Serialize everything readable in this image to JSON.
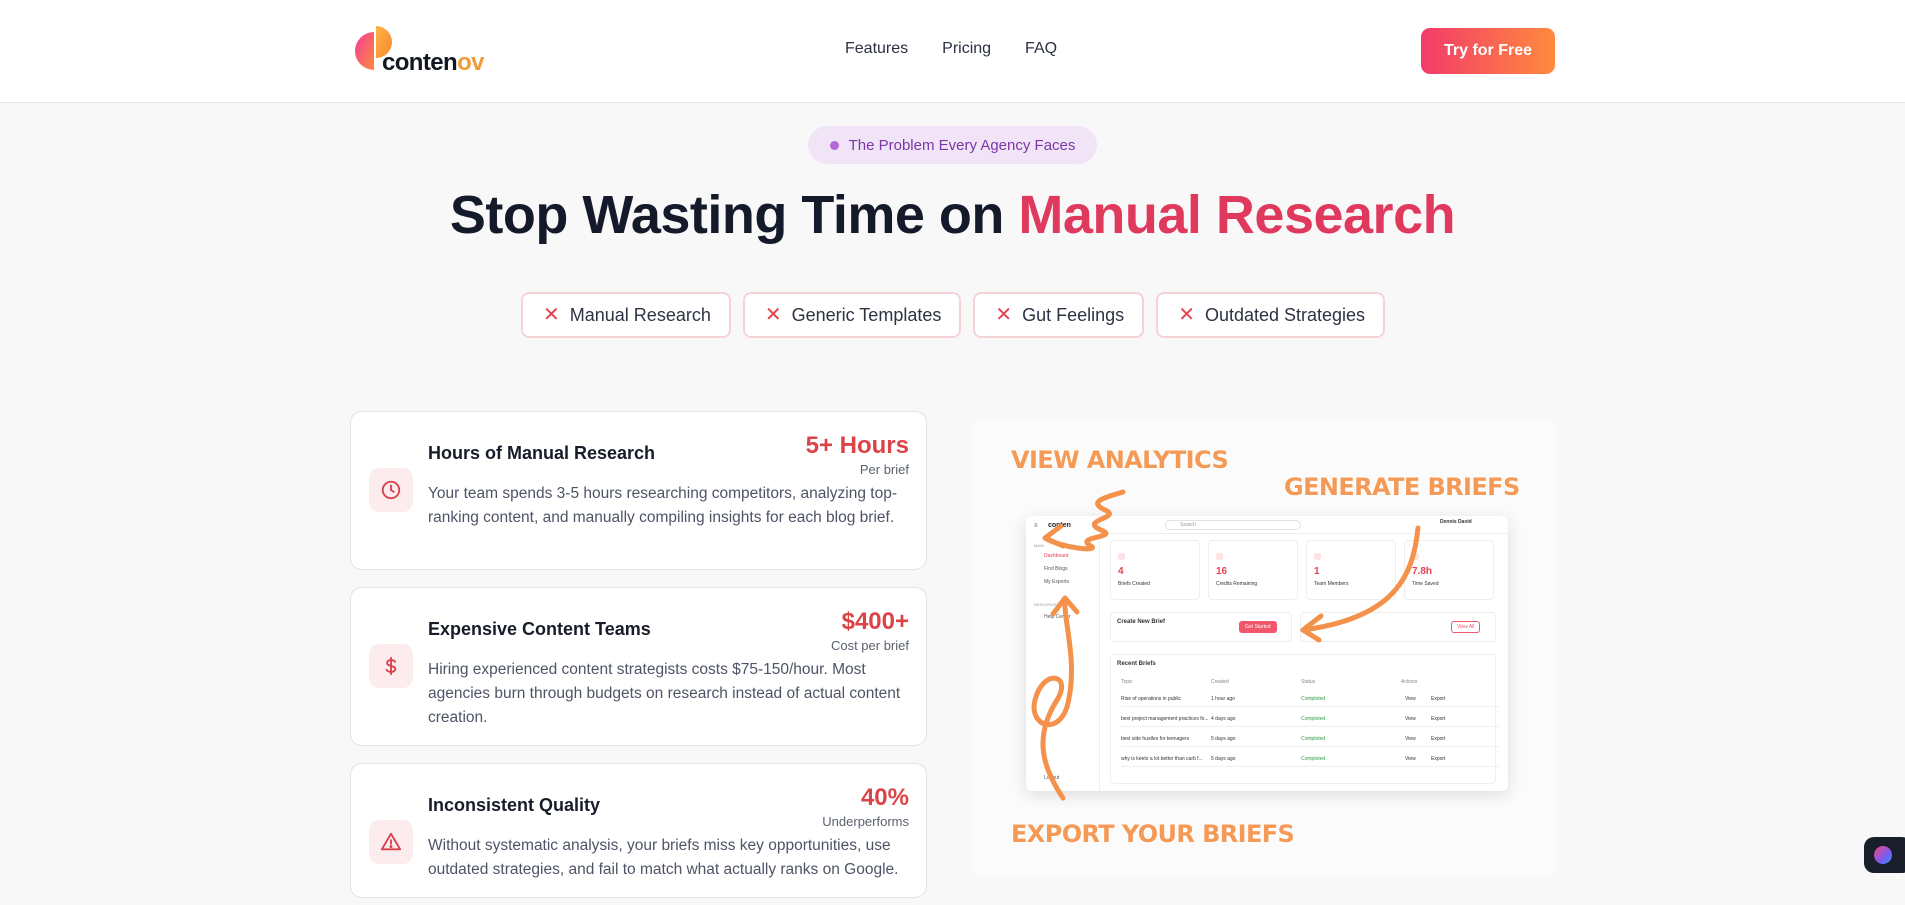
{
  "brand": {
    "name_main": "conten",
    "name_accent": "ov",
    "accent_color": "#f39a3a"
  },
  "nav": {
    "features": "Features",
    "pricing": "Pricing",
    "faq": "FAQ",
    "cta": "Try for Free"
  },
  "hero": {
    "pill": "The Problem Every Agency Faces",
    "title_main": "Stop Wasting Time on ",
    "title_accent": "Manual Research",
    "accent_color": "#e0395e",
    "tags": [
      "Manual Research",
      "Generic Templates",
      "Gut Feelings",
      "Outdated Strategies"
    ]
  },
  "problems": [
    {
      "icon": "clock-icon",
      "title": "Hours of Manual Research",
      "stat": "5+ Hours",
      "stat_caption": "Per brief",
      "description": "Your team spends 3-5 hours researching competitors, analyzing top-ranking content, and manually compiling insights for each blog brief."
    },
    {
      "icon": "dollar-icon",
      "title": "Expensive Content Teams",
      "stat": "$400+",
      "stat_caption": "Cost per brief",
      "description": "Hiring experienced content strategists costs $75-150/hour. Most agencies burn through budgets on research instead of actual content creation."
    },
    {
      "icon": "warning-icon",
      "title": "Inconsistent Quality",
      "stat": "40%",
      "stat_caption": "Underperforms",
      "description": "Without systematic analysis, your briefs miss key opportunities, use outdated strategies, and fail to match what actually ranks on Google."
    }
  ],
  "illustration": {
    "callout_analytics": "VIEW ANALYTICS",
    "callout_generate": "GENERATE BRIEFS",
    "callout_export": "EXPORT YOUR BRIEFS",
    "mock": {
      "search": "Search",
      "user": "Dennis David",
      "sidebar": [
        "Dashboard",
        "Find Blogs",
        "My Exports"
      ],
      "sidebar_section": "MAIN",
      "sidebar_resources": "RESOURCES",
      "help": "Help Center",
      "logout": "Logout",
      "stats": [
        {
          "value": "4",
          "label": "Briefs Created"
        },
        {
          "value": "16",
          "label": "Credits Remaining"
        },
        {
          "value": "1",
          "label": "Team Members"
        },
        {
          "value": "7.8h",
          "label": "Time Saved"
        }
      ],
      "create_title": "Create New Brief",
      "create_button": "Get Started",
      "view_all": "View All",
      "recent_title": "Recent Briefs",
      "columns": [
        "Topic",
        "Created",
        "Status",
        "Actions"
      ],
      "rows": [
        {
          "topic": "Rise of operations in public",
          "created": "1 hour ago",
          "status": "Completed"
        },
        {
          "topic": "best project management practices fo...",
          "created": "4 days ago",
          "status": "Completed"
        },
        {
          "topic": "best side hustles for teenagers",
          "created": "5 days ago",
          "status": "Completed"
        },
        {
          "topic": "why is keeto a lot better than carb f...",
          "created": "5 days ago",
          "status": "Completed"
        }
      ],
      "view": "View",
      "export": "Export"
    }
  }
}
